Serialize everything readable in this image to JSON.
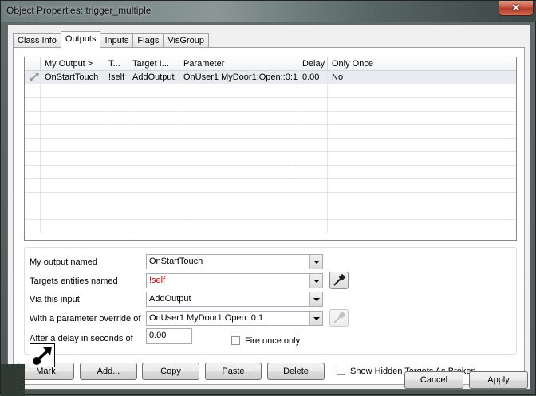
{
  "window": {
    "title": "Object Properties: trigger_multiple",
    "close_symbol": "✕"
  },
  "tabs": [
    {
      "label": "Class Info",
      "active": false
    },
    {
      "label": "Outputs",
      "active": true
    },
    {
      "label": "Inputs",
      "active": false
    },
    {
      "label": "Flags",
      "active": false
    },
    {
      "label": "VisGroup",
      "active": false
    }
  ],
  "list": {
    "columns": [
      "",
      "My Output  >",
      "T...",
      "Target I...",
      "Parameter",
      "Delay",
      "Only Once"
    ],
    "rows": [
      {
        "icon": "output-arrow-icon",
        "my_output": "OnStartTouch",
        "target": "!self",
        "target_input": "AddOutput",
        "parameter": "OnUser1 MyDoor1:Open::0:1",
        "delay": "0.00",
        "only_once": "No"
      }
    ]
  },
  "form": {
    "output_label": "My output named",
    "output_value": "OnStartTouch",
    "targets_label": "Targets entities named",
    "targets_value": "!self",
    "targets_color": "#cc0000",
    "input_label": "Via this input",
    "input_value": "AddOutput",
    "param_label": "With a parameter override of",
    "param_value": "OnUser1 MyDoor1:Open::0:1",
    "delay_label": "After a delay in seconds of",
    "delay_value": "0.00",
    "fire_once_label": "Fire once only",
    "fire_once_checked": false
  },
  "buttons": {
    "mark": "Mark",
    "add": "Add...",
    "copy": "Copy",
    "paste": "Paste",
    "delete": "Delete",
    "show_hidden_label": "Show Hidden Targets As Broken",
    "show_hidden_checked": false,
    "cancel": "Cancel",
    "apply": "Apply"
  }
}
